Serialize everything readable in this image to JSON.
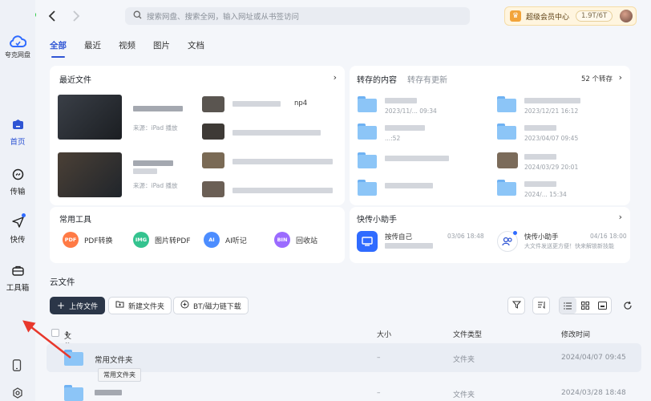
{
  "window": {
    "traffic_lights": [
      "close",
      "minimize",
      "zoom"
    ]
  },
  "app": {
    "logo_text": "夸克网盘"
  },
  "sidebar": {
    "items": [
      {
        "label": "首页",
        "icon": "home-icon",
        "active": true
      },
      {
        "label": "传输",
        "icon": "transfer-icon",
        "active": false
      },
      {
        "label": "快传",
        "icon": "send-icon",
        "active": false,
        "badge": true
      },
      {
        "label": "工具箱",
        "icon": "toolbox-icon",
        "active": false
      }
    ],
    "bottom_icons": [
      "phone-icon",
      "settings-icon"
    ]
  },
  "topbar": {
    "search_placeholder": "搜索网盘、搜索全网，输入网址或从书签访问",
    "vip_label": "超级会员中心",
    "quota": "1.9T/6T"
  },
  "tabs": [
    "全部",
    "最近",
    "视频",
    "图片",
    "文档"
  ],
  "recent": {
    "title": "最近文件",
    "items": [
      {
        "meta": "来源：iPad 播放"
      },
      {
        "name_suffix": "np4"
      },
      {
        "meta": "来源：iPad 播放"
      }
    ]
  },
  "saved": {
    "tab_active": "转存的内容",
    "tab_inactive": "转存有更新",
    "count": "52 个转存",
    "dates": [
      "2023/11/... 09:34",
      "2023/12/21 16:12",
      "...:52",
      "2023/04/07 09:45",
      "2024/03/29 20:01",
      "2024/... 15:34"
    ]
  },
  "tools": {
    "title": "常用工具",
    "items": [
      {
        "label": "PDF转换",
        "icon_text": "PDF",
        "color": "#ff7a45"
      },
      {
        "label": "图片转PDF",
        "icon_text": "IMG",
        "color": "#34c38f"
      },
      {
        "label": "AI听记",
        "icon_text": "AI",
        "color": "#4c8dff"
      },
      {
        "label": "回收站",
        "icon_text": "BIN",
        "color": "#9b6bff"
      }
    ]
  },
  "quick_send": {
    "title": "快传小助手",
    "items": [
      {
        "title": "按传自己",
        "date": "03/06 18:48"
      },
      {
        "title": "快传小助手",
        "date": "04/16 18:00",
        "desc": "大文件发送更方便！快来解锁新技能"
      }
    ]
  },
  "cloud": {
    "title": "云文件",
    "buttons": {
      "upload": "上传文件",
      "new_folder": "新建文件夹",
      "bt": "BT/磁力链下载"
    },
    "columns": {
      "name": "文件名",
      "size": "大小",
      "type": "文件类型",
      "modified": "修改时间"
    },
    "rows": [
      {
        "name": "常用文件夹",
        "size": "–",
        "type": "文件夹",
        "modified": "2024/04/07 09:45"
      },
      {
        "name": "",
        "size": "–",
        "type": "文件夹",
        "modified": "2024/03/28 18:48"
      }
    ],
    "tooltip": "常用文件夹"
  },
  "colors": {
    "accent": "#2f55d4",
    "arrow": "#e8382c",
    "primary_button": "#2b3648"
  }
}
